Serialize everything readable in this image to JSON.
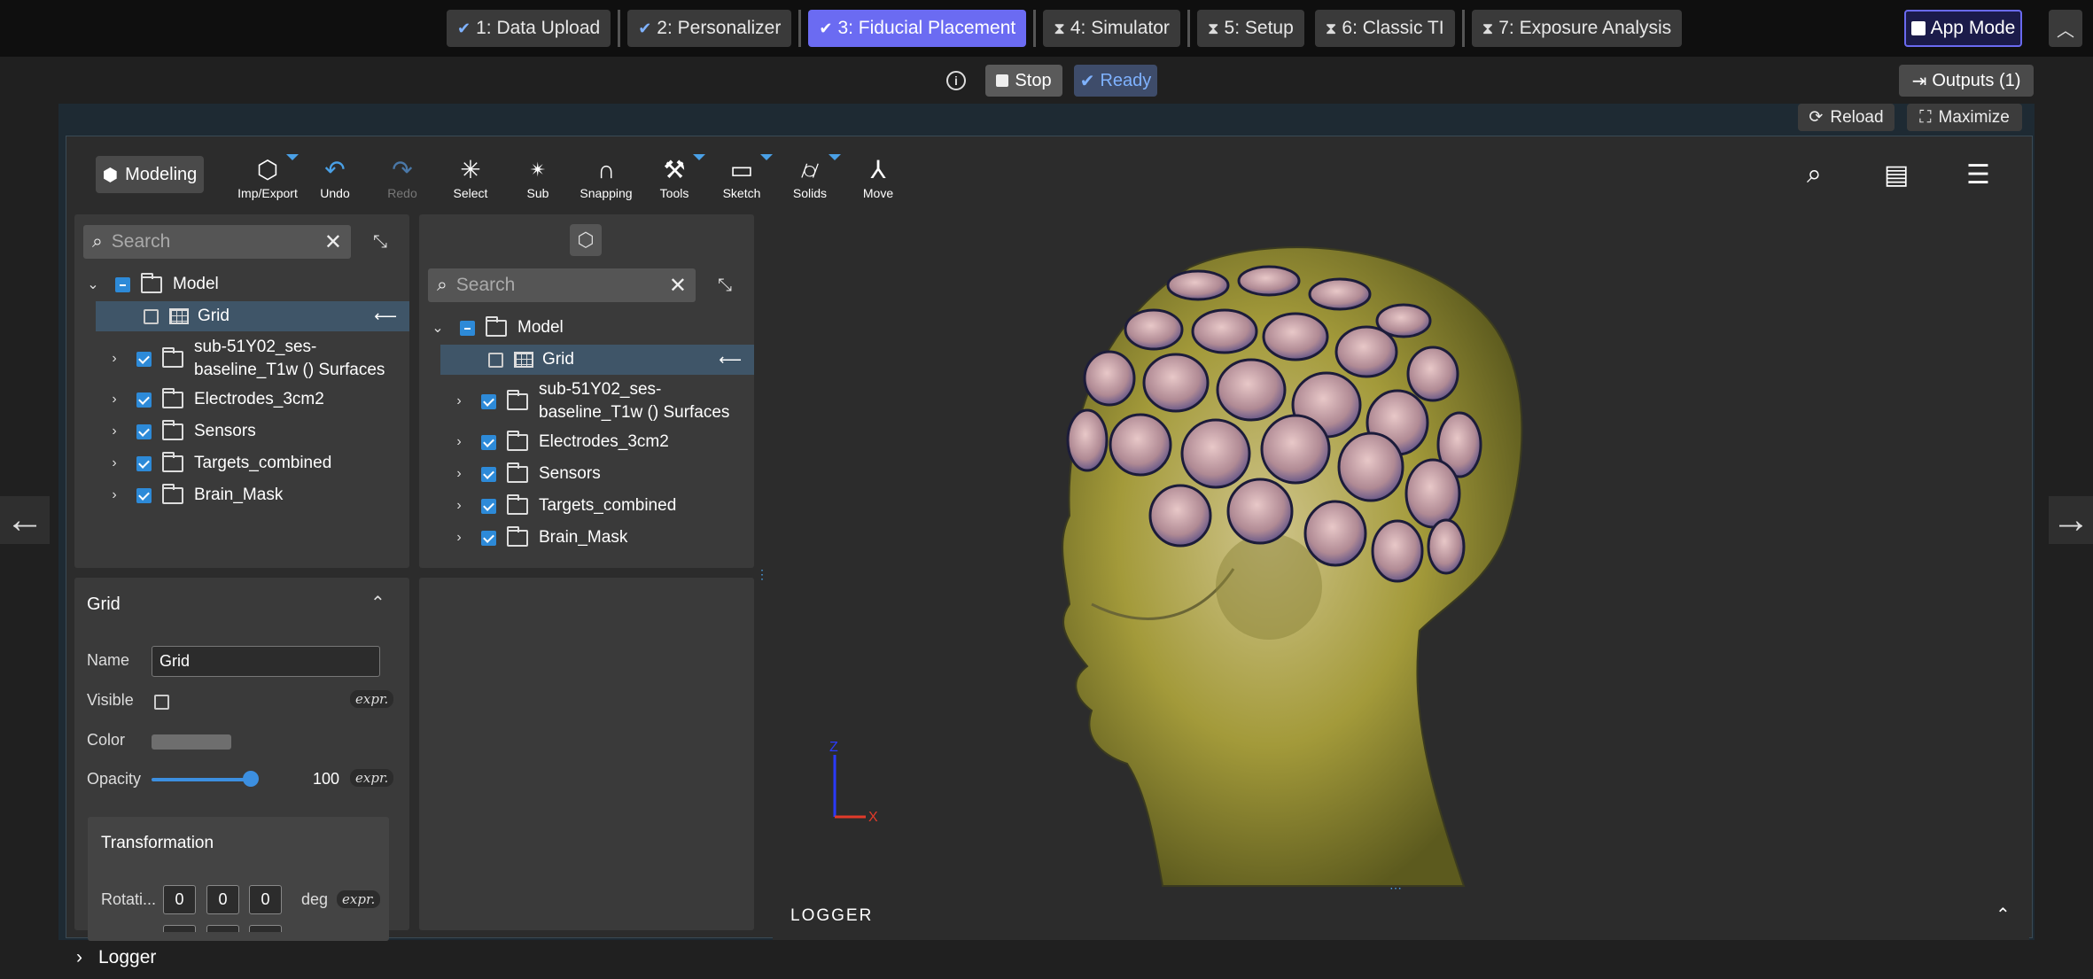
{
  "steps": [
    {
      "label": "1: Data Upload",
      "status": "done"
    },
    {
      "label": "2: Personalizer",
      "status": "done"
    },
    {
      "label": "3: Fiducial Placement",
      "status": "active"
    },
    {
      "label": "4: Simulator",
      "status": "pending"
    },
    {
      "label": "5: Setup",
      "status": "pending"
    },
    {
      "label": "6: Classic TI",
      "status": "pending"
    },
    {
      "label": "7: Exposure Analysis",
      "status": "pending"
    }
  ],
  "app_mode_label": "App Mode",
  "controls": {
    "stop_label": "Stop",
    "ready_label": "Ready",
    "outputs_label": "Outputs (1)"
  },
  "frame_buttons": {
    "reload_label": "Reload",
    "maximize_label": "Maximize"
  },
  "toolbar": {
    "modeling_label": "Modeling",
    "tools": [
      {
        "label": "Imp/Export",
        "icon": "import-export-icon",
        "caret": true,
        "disabled": false
      },
      {
        "label": "Undo",
        "icon": "undo-icon",
        "caret": false,
        "disabled": false
      },
      {
        "label": "Redo",
        "icon": "redo-icon",
        "caret": false,
        "disabled": true
      },
      {
        "label": "Select",
        "icon": "select-icon",
        "caret": false,
        "disabled": false
      },
      {
        "label": "Sub",
        "icon": "sub-select-icon",
        "caret": false,
        "disabled": false
      },
      {
        "label": "Snapping",
        "icon": "magnet-icon",
        "caret": false,
        "disabled": false
      },
      {
        "label": "Tools",
        "icon": "tools-icon",
        "caret": true,
        "disabled": false
      },
      {
        "label": "Sketch",
        "icon": "sketch-icon",
        "caret": true,
        "disabled": false
      },
      {
        "label": "Solids",
        "icon": "cylinder-icon",
        "caret": true,
        "disabled": false
      },
      {
        "label": "Move",
        "icon": "move-icon",
        "caret": false,
        "disabled": false
      }
    ]
  },
  "tree_left": {
    "search_placeholder": "Search",
    "root": "Model",
    "items": [
      "Grid",
      "sub-51Y02_ses-",
      "baseline_T1w () Surfaces",
      "Electrodes_3cm2",
      "Sensors",
      "Targets_combined",
      "Brain_Mask"
    ]
  },
  "tree_right": {
    "search_placeholder": "Search",
    "root": "Model",
    "items": [
      "Grid",
      "sub-51Y02_ses-",
      "baseline_T1w () Surfaces",
      "Electrodes_3cm2",
      "Sensors",
      "Targets_combined",
      "Brain_Mask"
    ]
  },
  "properties": {
    "title": "Grid",
    "name_label": "Name",
    "name_value": "Grid",
    "visible_label": "Visible",
    "color_label": "Color",
    "opacity_label": "Opacity",
    "opacity_value": "100",
    "expr": "expr.",
    "transformation_label": "Transformation",
    "rotation_label": "Rotati...",
    "rotation_values": [
      "0",
      "0",
      "0"
    ],
    "rotation_unit": "deg"
  },
  "viewport": {
    "axis_x": "X",
    "axis_z": "Z"
  },
  "logger": {
    "panel_title": "LOGGER",
    "bottom_label": "Logger"
  }
}
